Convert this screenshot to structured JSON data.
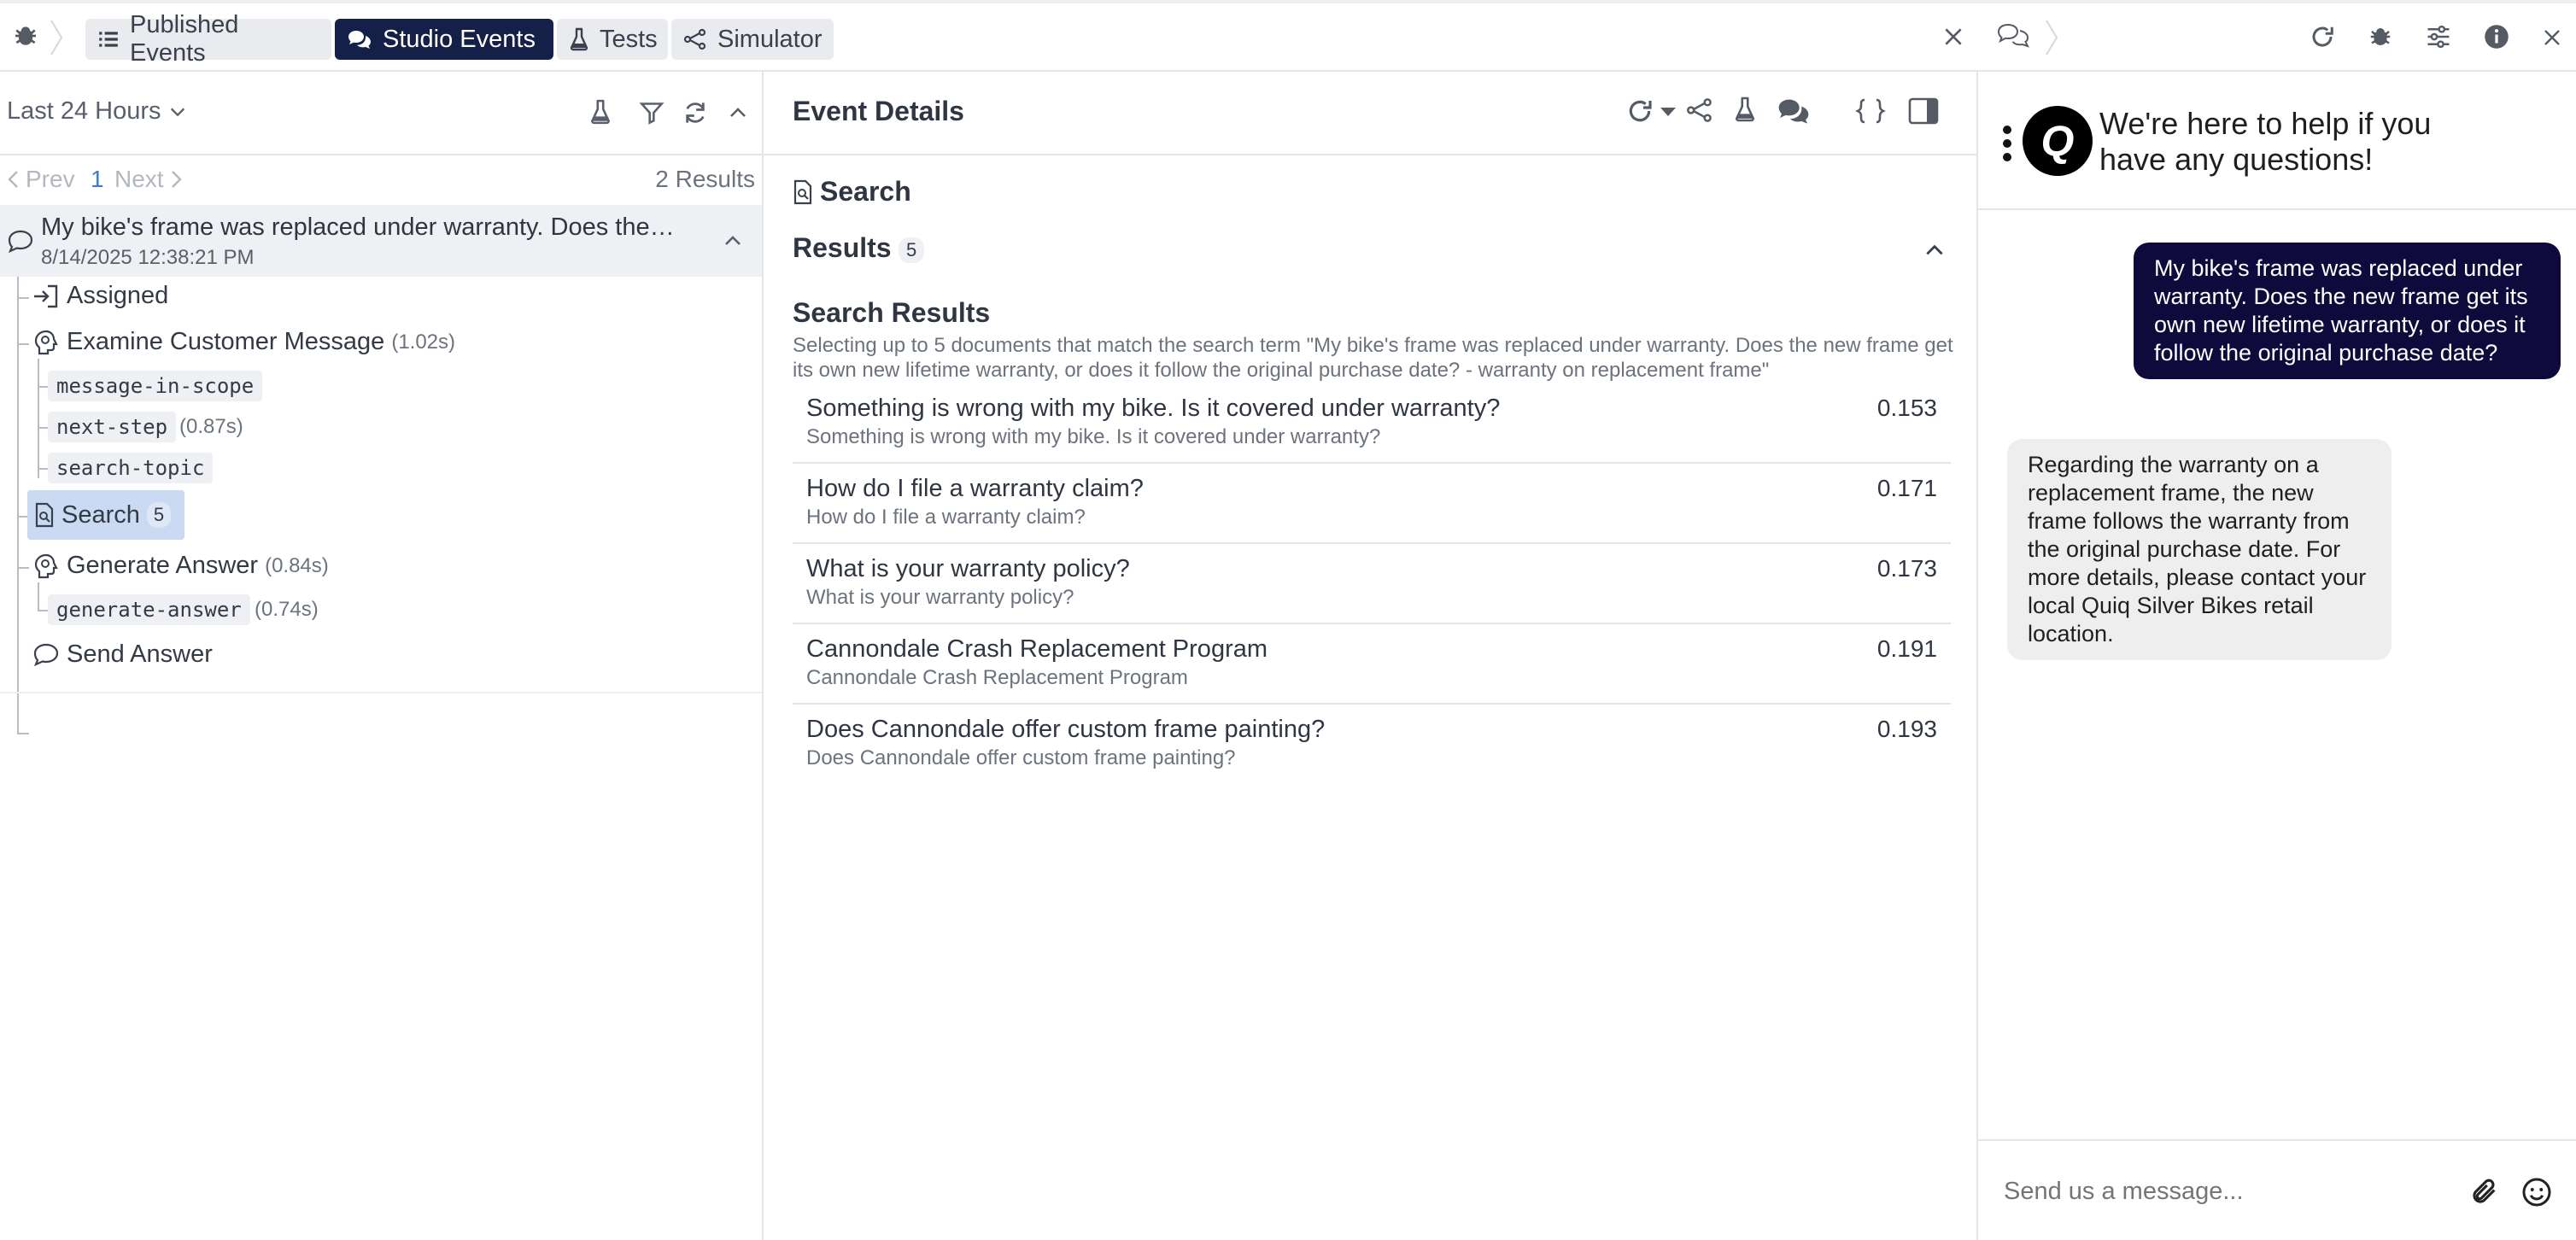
{
  "topbar": {
    "tabs": [
      {
        "label": "Published Events",
        "icon": "list-icon",
        "active": false
      },
      {
        "label": "Studio Events",
        "icon": "chat-bubbles-icon",
        "active": true
      },
      {
        "label": "Tests",
        "icon": "flask-icon",
        "active": false
      },
      {
        "label": "Simulator",
        "icon": "share-nodes-icon",
        "active": false
      }
    ],
    "accent": "#142047"
  },
  "left": {
    "time_range": "Last 24 Hours",
    "pagination": {
      "prev": "Prev",
      "page": "1",
      "next": "Next",
      "results": "2 Results"
    },
    "event": {
      "title": "My bike's frame was replaced under warranty. Does the…",
      "timestamp": "8/14/2025 12:38:21 PM"
    },
    "tree": {
      "assigned": "Assigned",
      "examine": {
        "label": "Examine Customer Message",
        "duration": "(1.02s)"
      },
      "tag_scope": "message-in-scope",
      "tag_next": "next-step",
      "tag_next_dur": "(0.87s)",
      "tag_topic": "search-topic",
      "search": {
        "label": "Search",
        "count": "5"
      },
      "generate": {
        "label": "Generate Answer",
        "duration": "(0.84s)"
      },
      "tag_generate": "generate-answer",
      "tag_generate_dur": "(0.74s)",
      "send": "Send Answer"
    }
  },
  "details": {
    "title": "Event Details",
    "node_label": "Search",
    "results_label": "Results",
    "results_count": "5",
    "section_title": "Search Results",
    "description": "Selecting up to 5 documents that match the search term \"My bike's frame was replaced under warranty. Does the new frame get its own new lifetime warranty, or does it follow the original purchase date? - warranty on replacement frame\"",
    "results": [
      {
        "title": "Something is wrong with my bike. Is it covered under warranty?",
        "subtitle": "Something is wrong with my bike. Is it covered under warranty?",
        "score": "0.153"
      },
      {
        "title": "How do I file a warranty claim?",
        "subtitle": "How do I file a warranty claim?",
        "score": "0.171"
      },
      {
        "title": "What is your warranty policy?",
        "subtitle": "What is your warranty policy?",
        "score": "0.173"
      },
      {
        "title": "Cannondale Crash Replacement Program",
        "subtitle": "Cannondale Crash Replacement Program",
        "score": "0.191"
      },
      {
        "title": "Does Cannondale offer custom frame painting?",
        "subtitle": "Does Cannondale offer custom frame painting?",
        "score": "0.193"
      }
    ]
  },
  "chat": {
    "header_text": "We're here to help if you have any questions!",
    "logo_letter": "Q",
    "user_message": "My bike's frame was replaced under warranty. Does the new frame get its own new lifetime warranty, or does it follow the original purchase date?",
    "bot_message": "Regarding the warranty on a replacement frame, the new frame follows the warranty from the original purchase date. For more details, please contact your local Quiq Silver Bikes retail location.",
    "input_placeholder": "Send us a message...",
    "user_bubble_color": "#0e0b3c",
    "bot_bubble_color": "#eeeeee"
  }
}
